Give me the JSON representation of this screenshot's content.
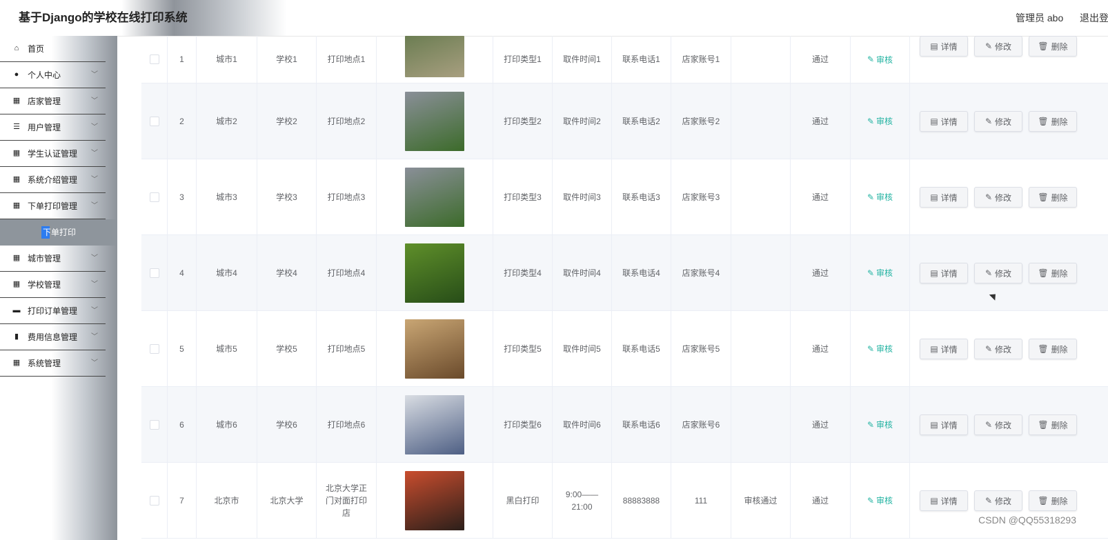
{
  "topbar": {
    "title": "基于Django的学校在线打印系统",
    "admin": "管理员 abo",
    "logout": "退出登"
  },
  "sidebar": {
    "items": [
      {
        "label": "首页",
        "icon": "home-icon",
        "glyph": "⌂",
        "chevron": false
      },
      {
        "label": "个人中心",
        "icon": "user-icon",
        "glyph": "●",
        "chevron": true
      },
      {
        "label": "店家管理",
        "icon": "grid-icon",
        "glyph": "▦",
        "chevron": true
      },
      {
        "label": "用户管理",
        "icon": "list-icon",
        "glyph": "☰",
        "chevron": true
      },
      {
        "label": "学生认证管理",
        "icon": "grid-icon",
        "glyph": "▦",
        "chevron": true
      },
      {
        "label": "系统介绍管理",
        "icon": "grid-icon",
        "glyph": "▦",
        "chevron": true
      },
      {
        "label": "下单打印管理",
        "icon": "grid-icon",
        "glyph": "▦",
        "chevron": true
      },
      {
        "label": "城市管理",
        "icon": "grid-icon",
        "glyph": "▦",
        "chevron": true
      },
      {
        "label": "学校管理",
        "icon": "grid-icon",
        "glyph": "▦",
        "chevron": true
      },
      {
        "label": "打印订单管理",
        "icon": "printer-icon",
        "glyph": "▬",
        "chevron": true
      },
      {
        "label": "费用信息管理",
        "icon": "chart-icon",
        "glyph": "▮",
        "chevron": true
      },
      {
        "label": "系统管理",
        "icon": "grid-icon",
        "glyph": "▦",
        "chevron": true
      }
    ],
    "active_submenu": "下单打印",
    "chevron_glyph": "﹀"
  },
  "table": {
    "rows": [
      {
        "index": "1",
        "city": "城市1",
        "school": "学校1",
        "location": "打印地点1",
        "type": "打印类型1",
        "pickup": "取件时间1",
        "phone": "联系电话1",
        "account": "店家账号1",
        "reply": "",
        "status": "通过",
        "colors": [
          "#6b7d52",
          "#a89f80"
        ]
      },
      {
        "index": "2",
        "city": "城市2",
        "school": "学校2",
        "location": "打印地点2",
        "type": "打印类型2",
        "pickup": "取件时间2",
        "phone": "联系电话2",
        "account": "店家账号2",
        "reply": "",
        "status": "通过",
        "colors": [
          "#8a8f98",
          "#3c6b2a"
        ]
      },
      {
        "index": "3",
        "city": "城市3",
        "school": "学校3",
        "location": "打印地点3",
        "type": "打印类型3",
        "pickup": "取件时间3",
        "phone": "联系电话3",
        "account": "店家账号3",
        "reply": "",
        "status": "通过",
        "colors": [
          "#8a8f98",
          "#3c6b2a"
        ]
      },
      {
        "index": "4",
        "city": "城市4",
        "school": "学校4",
        "location": "打印地点4",
        "type": "打印类型4",
        "pickup": "取件时间4",
        "phone": "联系电话4",
        "account": "店家账号4",
        "reply": "",
        "status": "通过",
        "colors": [
          "#5f8f2a",
          "#274d18"
        ]
      },
      {
        "index": "5",
        "city": "城市5",
        "school": "学校5",
        "location": "打印地点5",
        "type": "打印类型5",
        "pickup": "取件时间5",
        "phone": "联系电话5",
        "account": "店家账号5",
        "reply": "",
        "status": "通过",
        "colors": [
          "#c9a674",
          "#6a4a2b"
        ]
      },
      {
        "index": "6",
        "city": "城市6",
        "school": "学校6",
        "location": "打印地点6",
        "type": "打印类型6",
        "pickup": "取件时间6",
        "phone": "联系电话6",
        "account": "店家账号6",
        "reply": "",
        "status": "通过",
        "colors": [
          "#d9dde3",
          "#4e5f84"
        ]
      },
      {
        "index": "7",
        "city": "北京市",
        "school": "北京大学",
        "location": "北京大学正门对面打印店",
        "type": "黑白打印",
        "pickup": "9:00——21:00",
        "phone": "88883888",
        "account": "111",
        "reply": "审核通过",
        "status": "通过",
        "colors": [
          "#c94d2e",
          "#2b1f1a"
        ]
      }
    ],
    "audit_label": "审核",
    "buttons": {
      "detail": "详情",
      "edit": "修改",
      "delete": "删除"
    }
  },
  "watermark": "CSDN @QQ55318293"
}
